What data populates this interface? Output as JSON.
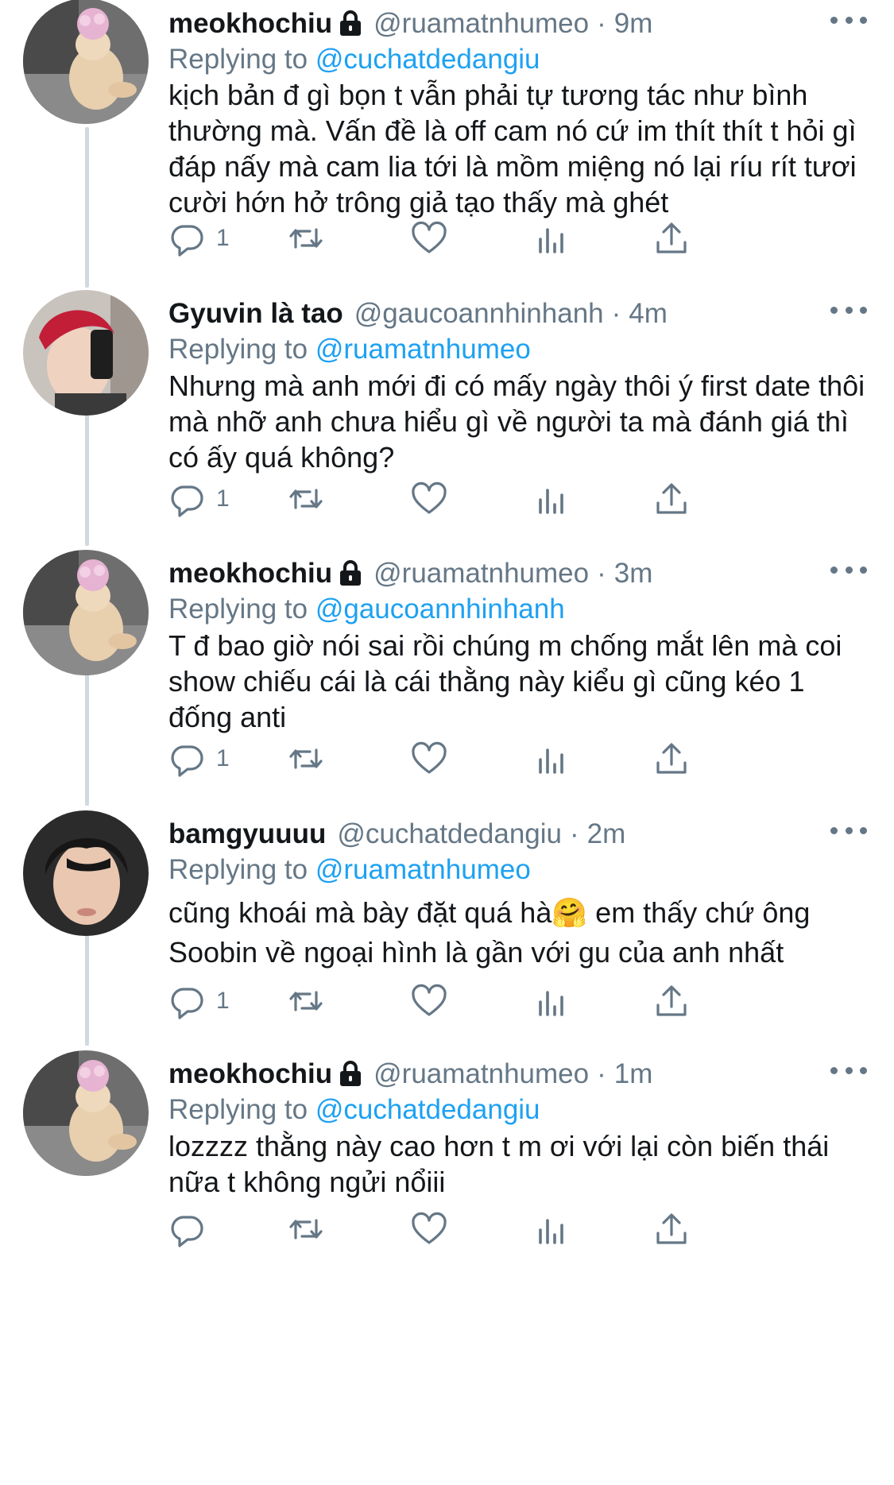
{
  "tweets": [
    {
      "name": "meokhochiu",
      "locked": true,
      "handle": "@ruamatnhumeo",
      "time": "9m",
      "replying_label": "Replying to",
      "replying_to": "@cuchatdedangiu",
      "text": "kịch bản đ gì bọn t vẫn phải tự tương tác như bình thường mà. Vấn đề là off cam nó cứ im thít thít t hỏi gì đáp nấy mà cam lia tới là mồm miệng nó lại ríu rít tươi cười hớn hở trông giả tạo thấy mà ghét",
      "reply_count": "1",
      "avatar": "cat-avatar"
    },
    {
      "name": "Gyuvin là tao",
      "locked": false,
      "handle": "@gaucoannhinhanh",
      "time": "4m",
      "replying_label": "Replying to",
      "replying_to": "@ruamatnhumeo",
      "text": "Nhưng mà anh mới đi có mấy ngày thôi ý first date thôi mà nhỡ anh chưa hiểu gì về người ta mà đánh giá thì có ấy quá không?",
      "reply_count": "1",
      "avatar": "red-hair-selfie-avatar"
    },
    {
      "name": "meokhochiu",
      "locked": true,
      "handle": "@ruamatnhumeo",
      "time": "3m",
      "replying_label": "Replying to",
      "replying_to": "@gaucoannhinhanh",
      "text": "T đ bao giờ nói sai rồi chúng m chống mắt lên mà coi show chiếu cái là cái thằng này kiểu gì cũng kéo 1 đống anti",
      "reply_count": "1",
      "avatar": "cat-avatar"
    },
    {
      "name": "bamgyuuuu",
      "locked": false,
      "handle": "@cuchatdedangiu",
      "time": "2m",
      "replying_label": "Replying to",
      "replying_to": "@ruamatnhumeo",
      "text": "cũng khoái mà bày đặt quá hà🤗 em thấy chứ ông Soobin về ngoại hình là gần với gu của anh nhất",
      "reply_count": "1",
      "avatar": "dark-hair-avatar"
    },
    {
      "name": "meokhochiu",
      "locked": true,
      "handle": "@ruamatnhumeo",
      "time": "1m",
      "replying_label": "Replying to",
      "replying_to": "@cuchatdedangiu",
      "text": "lozzzz thằng này cao hơn t m ơi với lại còn biến thái nữa t không ngửi nổiii",
      "reply_count": "",
      "avatar": "cat-avatar"
    }
  ],
  "colors": {
    "text": "#14171a",
    "secondary": "#657786",
    "link": "#1da1f2",
    "thread_line": "#cfd9de"
  },
  "icons": [
    "lock-icon",
    "more-icon",
    "reply-icon",
    "retweet-icon",
    "like-icon",
    "analytics-icon",
    "share-icon"
  ]
}
